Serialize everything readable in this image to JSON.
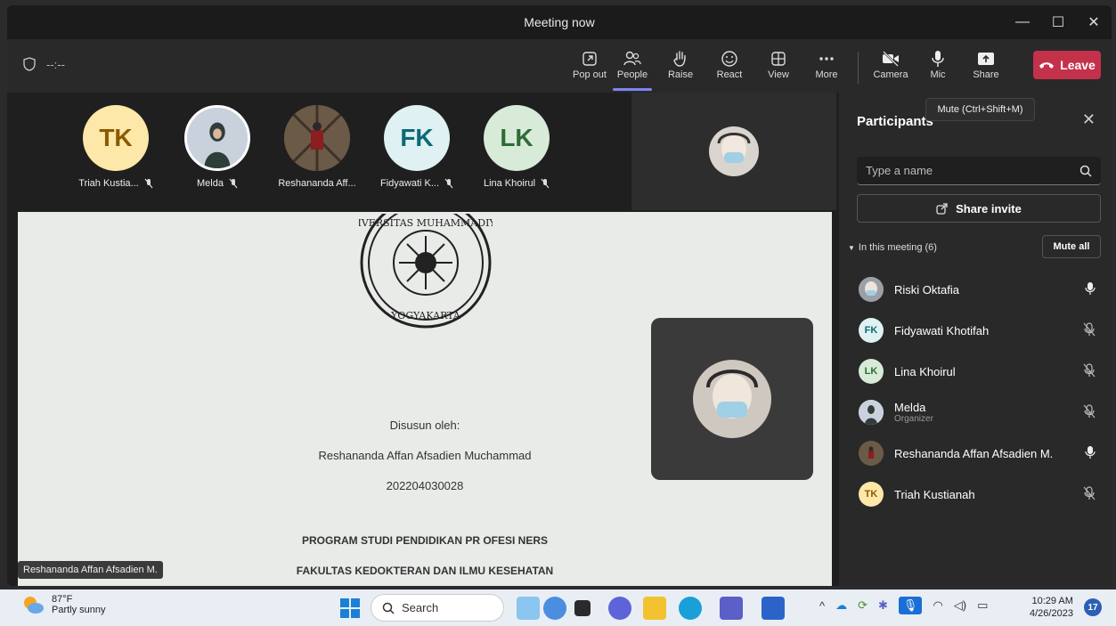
{
  "window": {
    "title": "Meeting now",
    "controls": [
      "—",
      "☐",
      "✕"
    ]
  },
  "toolbar": {
    "timer": "--:--",
    "buttons": [
      {
        "label": "Pop out",
        "icon": "popout-icon"
      },
      {
        "label": "People",
        "icon": "people-icon"
      },
      {
        "label": "Raise",
        "icon": "raise-hand-icon"
      },
      {
        "label": "React",
        "icon": "react-icon"
      },
      {
        "label": "View",
        "icon": "view-icon"
      },
      {
        "label": "More",
        "icon": "more-icon"
      },
      {
        "label": "Camera",
        "icon": "camera-off-icon"
      },
      {
        "label": "Mic",
        "icon": "mic-icon"
      },
      {
        "label": "Share",
        "icon": "share-icon"
      }
    ],
    "leave_label": "Leave",
    "tooltip": "Mute (Ctrl+Shift+M)"
  },
  "gallery": [
    {
      "initials": "TK",
      "name": "Triah Kustia...",
      "bg": "#fde7a9",
      "fg": "#8a5a00",
      "photo": false
    },
    {
      "initials": "",
      "name": "Melda",
      "bg": "#d7dde3",
      "fg": "#333",
      "photo": true
    },
    {
      "initials": "",
      "name": "Reshananda Aff...",
      "bg": "#5a4a3a",
      "fg": "#fff",
      "photo": true
    },
    {
      "initials": "FK",
      "name": "Fidyawati K...",
      "bg": "#dff1f3",
      "fg": "#0b6a76",
      "photo": false
    },
    {
      "initials": "LK",
      "name": "Lina Khoirul",
      "bg": "#d8ead8",
      "fg": "#2f6b35",
      "photo": false
    }
  ],
  "share": {
    "lines": [
      "Disusun oleh:",
      "Reshananda Affan Afsadien Muchammad",
      "202204030028",
      "PROGRAM STUDI PENDIDIKAN PR OFESI NERS",
      "FAKULTAS KEDOKTERAN DAN ILMU KESEHATAN"
    ],
    "presenter": "Reshananda Affan Afsadien M."
  },
  "panel": {
    "title": "Participants",
    "search_placeholder": "Type a name",
    "invite_label": "Share invite",
    "section_label": "In this meeting (6)",
    "mute_all": "Mute all",
    "participants": [
      {
        "name": "Riski Oktafia",
        "role": "",
        "initials": "",
        "bg": "#8a8f96",
        "fg": "#fff",
        "mic": "on"
      },
      {
        "name": "Fidyawati Khotifah",
        "role": "",
        "initials": "FK",
        "bg": "#dff1f3",
        "fg": "#0b6a76",
        "mic": "off"
      },
      {
        "name": "Lina Khoirul",
        "role": "",
        "initials": "LK",
        "bg": "#d8ead8",
        "fg": "#2f6b35",
        "mic": "off"
      },
      {
        "name": "Melda",
        "role": "Organizer",
        "initials": "",
        "bg": "#d7dde3",
        "fg": "#333",
        "mic": "off"
      },
      {
        "name": "Reshananda Affan Afsadien M.",
        "role": "",
        "initials": "",
        "bg": "#5a4a3a",
        "fg": "#fff",
        "mic": "on"
      },
      {
        "name": "Triah Kustianah",
        "role": "",
        "initials": "TK",
        "bg": "#fde7a9",
        "fg": "#8a5a00",
        "mic": "off"
      }
    ]
  },
  "taskbar": {
    "weather_temp": "87°F",
    "weather_desc": "Partly sunny",
    "search_label": "Search",
    "time": "10:29 AM",
    "date": "4/26/2023",
    "notifications": "17"
  },
  "colors": {
    "accent": "#7f85f5",
    "leave": "#c4314b"
  }
}
